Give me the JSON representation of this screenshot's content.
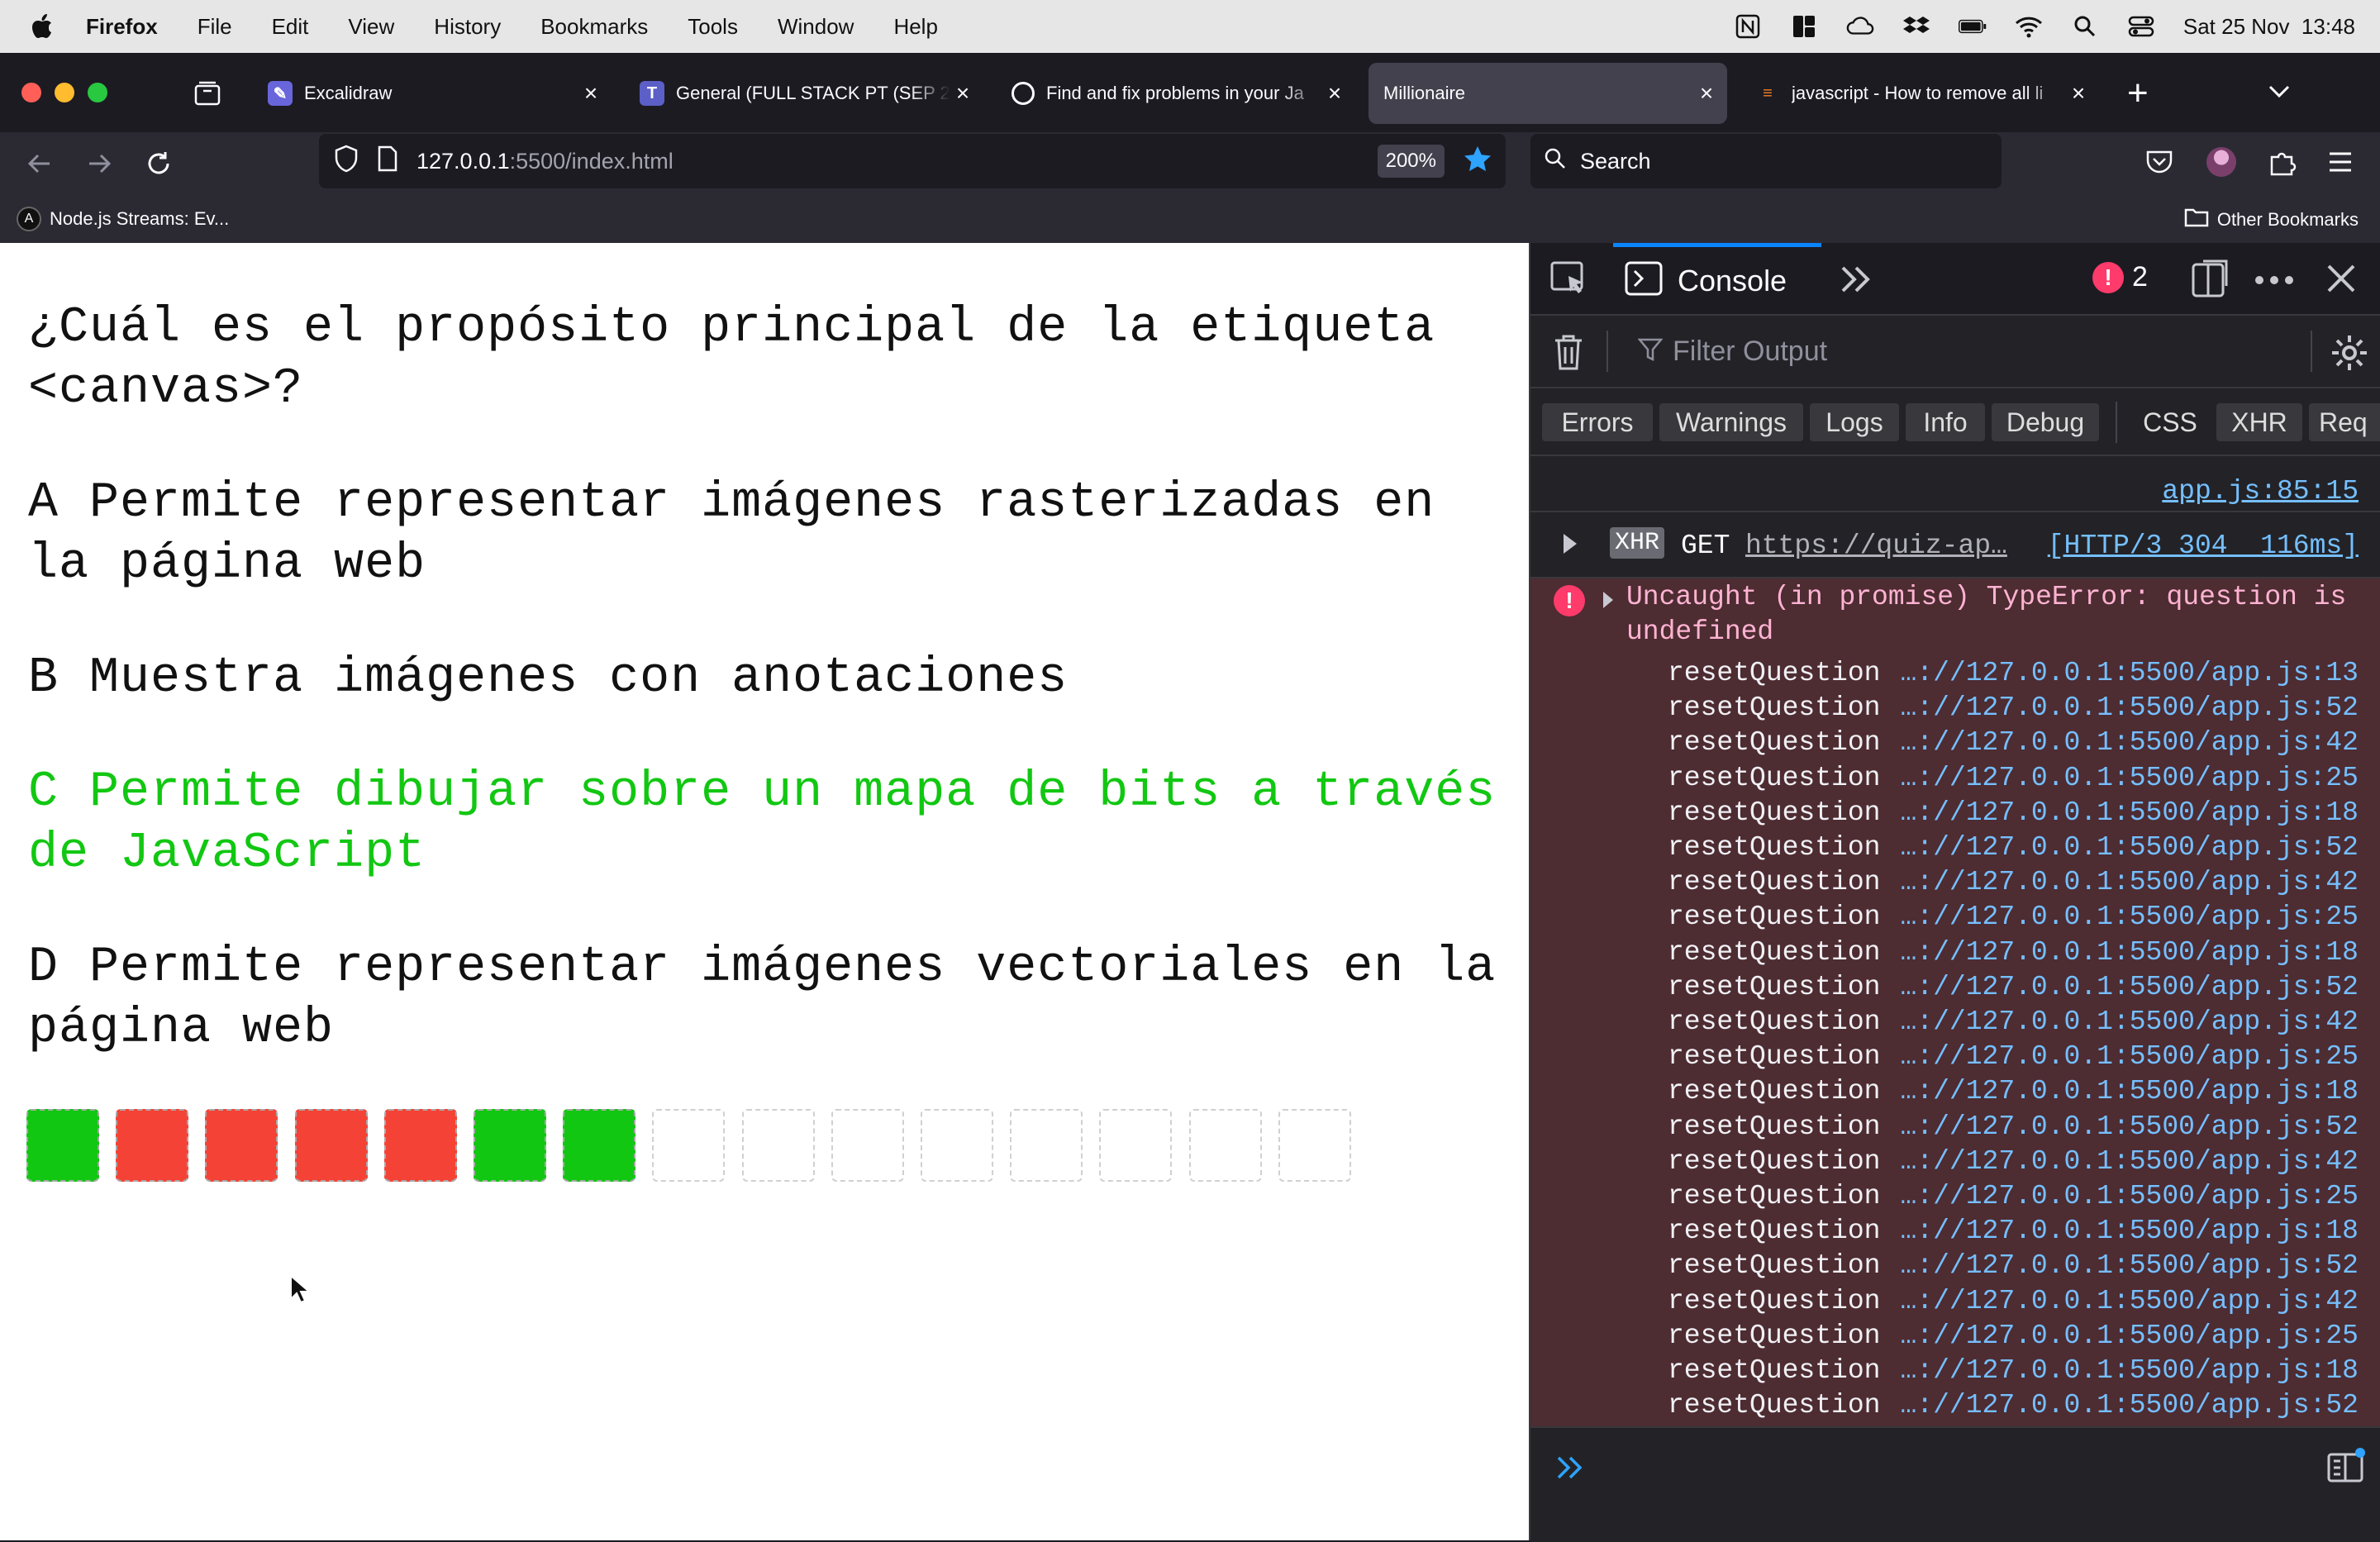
{
  "menubar": {
    "app": "Firefox",
    "items": [
      "File",
      "Edit",
      "View",
      "History",
      "Bookmarks",
      "Tools",
      "Window",
      "Help"
    ],
    "datetime": "Sat 25 Nov  13:48"
  },
  "tabs": [
    {
      "title": "Excalidraw",
      "icon": "excalidraw-icon"
    },
    {
      "title": "General (FULL STACK PT (SEP 2",
      "icon": "teams-icon"
    },
    {
      "title": "Find and fix problems in your Ja",
      "icon": "eslint-icon"
    },
    {
      "title": "Millionaire",
      "icon": ""
    },
    {
      "title": "javascript - How to remove all li",
      "icon": "stackoverflow-icon"
    }
  ],
  "toolbar": {
    "url_host": "127.0.0.1",
    "url_rest": ":5500/index.html",
    "zoom": "200%",
    "search_placeholder": "Search"
  },
  "bookmarks": {
    "item": "Node.js Streams: Ev...",
    "other": "Other Bookmarks"
  },
  "quiz": {
    "question": "¿Cuál es el propósito principal de la etiqueta <canvas>?",
    "options": [
      {
        "letter": "A",
        "text": "Permite representar imágenes rasterizadas en la página web",
        "state": "normal"
      },
      {
        "letter": "B",
        "text": "Muestra imágenes con anotaciones",
        "state": "normal"
      },
      {
        "letter": "C",
        "text": "Permite dibujar sobre un mapa de bits a través de JavaScript",
        "state": "correct"
      },
      {
        "letter": "D",
        "text": "Permite representar imágenes vectoriales en la página web",
        "state": "normal"
      }
    ],
    "progress": [
      "correct",
      "wrong",
      "wrong",
      "wrong",
      "wrong",
      "correct",
      "correct",
      "empty",
      "empty",
      "empty",
      "empty",
      "empty",
      "empty",
      "empty",
      "empty"
    ],
    "colors": {
      "correct": "#12c712",
      "wrong": "#f44336",
      "empty_border": "#d0d0d0"
    }
  },
  "devtools": {
    "active_tab": "Console",
    "error_count": "2",
    "filter_placeholder": "Filter Output",
    "categories": [
      "Errors",
      "Warnings",
      "Logs",
      "Info",
      "Debug",
      "CSS",
      "XHR",
      "Req"
    ],
    "log_source": "app.js:85:15",
    "xhr": {
      "badge": "XHR",
      "method": "GET",
      "url": "https://quiz-ap…",
      "status": "[HTTP/3 304  116ms]"
    },
    "error": {
      "message": "Uncaught (in promise) TypeError: question is undefined",
      "stack": [
        {
          "fn": "resetQuestion",
          "loc": "…://127.0.0.1:5500/app.js:13"
        },
        {
          "fn": "resetQuestion",
          "loc": "…://127.0.0.1:5500/app.js:52"
        },
        {
          "fn": "resetQuestion",
          "loc": "…://127.0.0.1:5500/app.js:42"
        },
        {
          "fn": "resetQuestion",
          "loc": "…://127.0.0.1:5500/app.js:25"
        },
        {
          "fn": "resetQuestion",
          "loc": "…://127.0.0.1:5500/app.js:18"
        },
        {
          "fn": "resetQuestion",
          "loc": "…://127.0.0.1:5500/app.js:52"
        },
        {
          "fn": "resetQuestion",
          "loc": "…://127.0.0.1:5500/app.js:42"
        },
        {
          "fn": "resetQuestion",
          "loc": "…://127.0.0.1:5500/app.js:25"
        },
        {
          "fn": "resetQuestion",
          "loc": "…://127.0.0.1:5500/app.js:18"
        },
        {
          "fn": "resetQuestion",
          "loc": "…://127.0.0.1:5500/app.js:52"
        },
        {
          "fn": "resetQuestion",
          "loc": "…://127.0.0.1:5500/app.js:42"
        },
        {
          "fn": "resetQuestion",
          "loc": "…://127.0.0.1:5500/app.js:25"
        },
        {
          "fn": "resetQuestion",
          "loc": "…://127.0.0.1:5500/app.js:18"
        },
        {
          "fn": "resetQuestion",
          "loc": "…://127.0.0.1:5500/app.js:52"
        },
        {
          "fn": "resetQuestion",
          "loc": "…://127.0.0.1:5500/app.js:42"
        },
        {
          "fn": "resetQuestion",
          "loc": "…://127.0.0.1:5500/app.js:25"
        },
        {
          "fn": "resetQuestion",
          "loc": "…://127.0.0.1:5500/app.js:18"
        },
        {
          "fn": "resetQuestion",
          "loc": "…://127.0.0.1:5500/app.js:52"
        },
        {
          "fn": "resetQuestion",
          "loc": "…://127.0.0.1:5500/app.js:42"
        },
        {
          "fn": "resetQuestion",
          "loc": "…://127.0.0.1:5500/app.js:25"
        },
        {
          "fn": "resetQuestion",
          "loc": "…://127.0.0.1:5500/app.js:18"
        },
        {
          "fn": "resetQuestion",
          "loc": "…://127.0.0.1:5500/app.js:52"
        }
      ]
    }
  }
}
